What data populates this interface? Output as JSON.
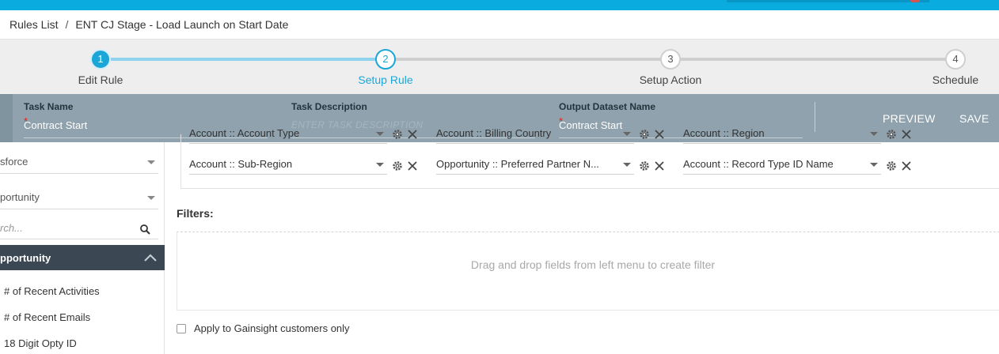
{
  "breadcrumb": {
    "parent": "Rules List",
    "separator": "/",
    "current": "ENT CJ Stage - Load Launch on Start Date"
  },
  "steps": [
    {
      "number": "1",
      "label": "Edit Rule",
      "state": "done"
    },
    {
      "number": "2",
      "label": "Setup Rule",
      "state": "active"
    },
    {
      "number": "3",
      "label": "Setup Action",
      "state": "todo"
    },
    {
      "number": "4",
      "label": "Schedule",
      "state": "todo"
    }
  ],
  "task": {
    "name_label": "Task Name",
    "name_value": "Contract Start",
    "description_label": "Task Description",
    "description_placeholder": "ENTER TASK DESCRIPTION",
    "output_label": "Output Dataset Name",
    "output_value": "Contract Start",
    "required_mark": "*",
    "preview_label": "PREVIEW",
    "save_label": "SAVE"
  },
  "sidebar": {
    "source_select": "sforce",
    "object_select": "portunity",
    "search_placeholder": "rch...",
    "section_title": "pportunity",
    "items": [
      "# of Recent Activities",
      "# of Recent Emails",
      "18 Digit Opty ID"
    ]
  },
  "fields": {
    "row1": [
      "Account :: Account Type",
      "Account :: Billing Country",
      "Account :: Region"
    ],
    "row2": [
      "Account :: Sub-Region",
      "Opportunity :: Preferred Partner N...",
      "Account :: Record Type ID Name"
    ]
  },
  "filters": {
    "title": "Filters:",
    "dropzone_text": "Drag and drop fields from left menu to create filter",
    "apply_label": "Apply to Gainsight customers only",
    "apply_checked": false
  },
  "colors": {
    "accent": "#1aa7d8",
    "topbar": "#0aace0",
    "taskbar": "#8fa2ad",
    "section_dark": "#3b4753"
  }
}
